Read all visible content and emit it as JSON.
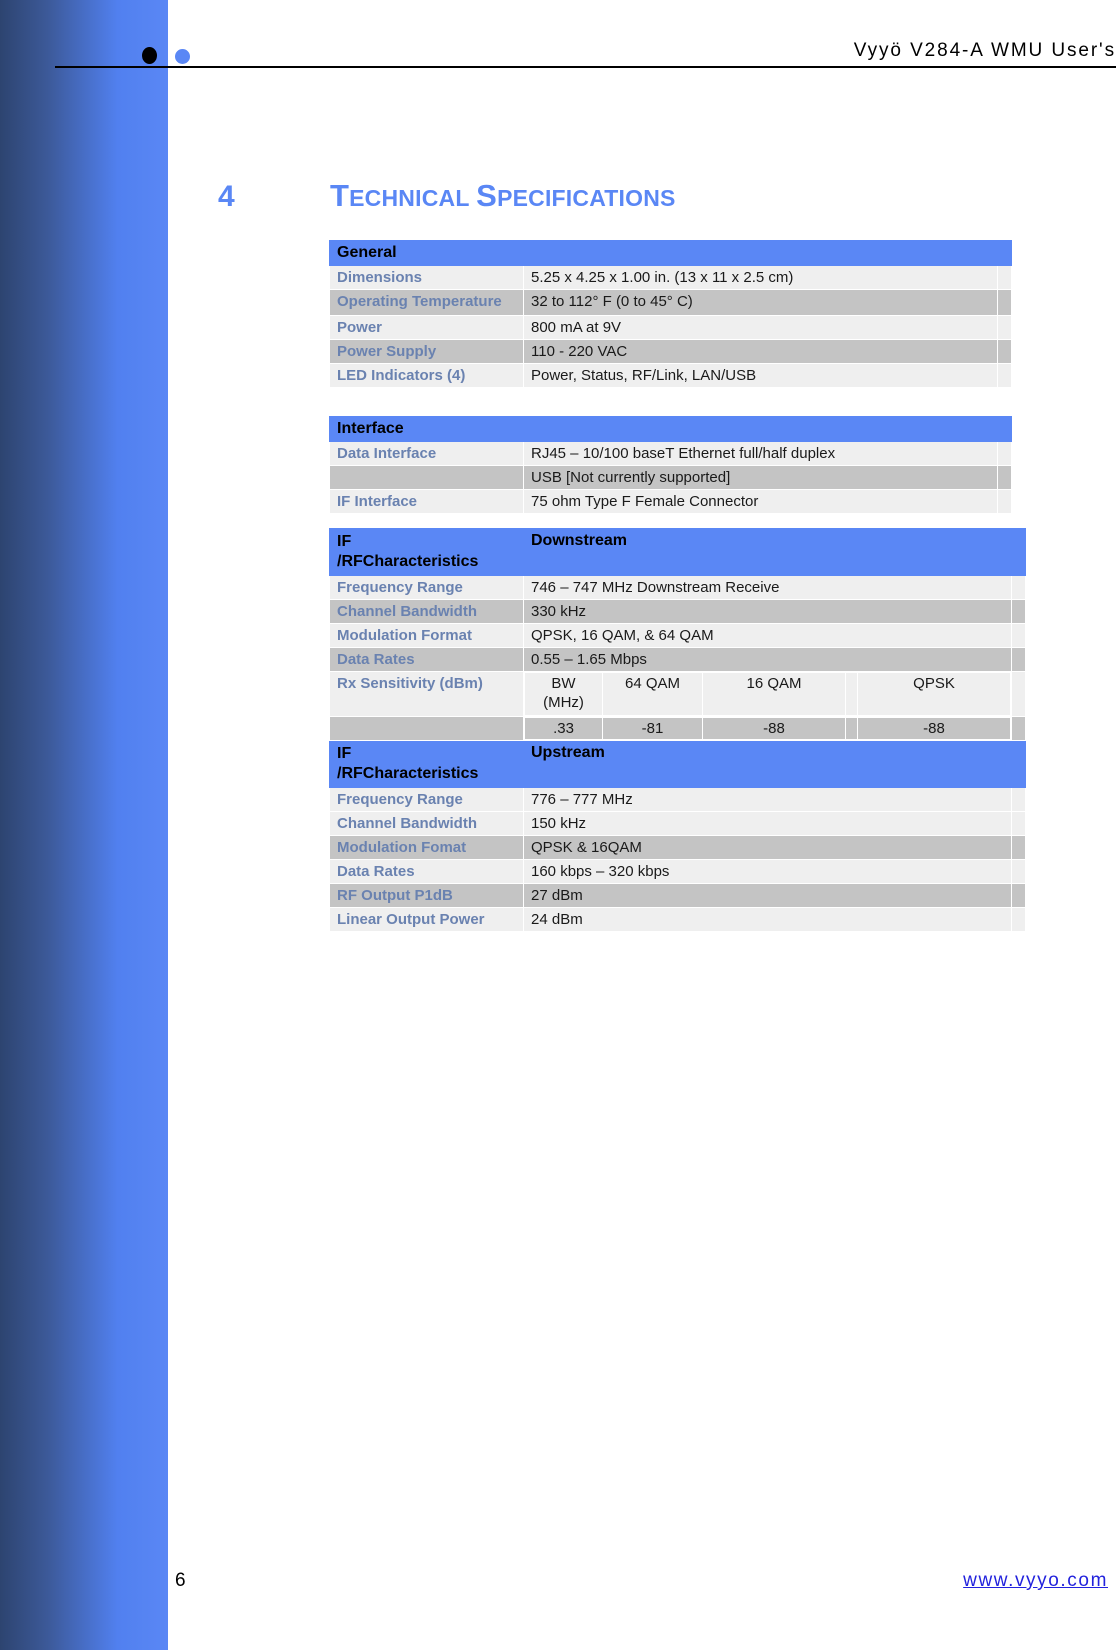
{
  "header": {
    "title": "Vyyö V284-A WMU User's",
    "logo_black_dot": "black-circle",
    "logo_blue_dot": "blue-circle"
  },
  "heading": {
    "number": "4",
    "title_parts": [
      {
        "cap": "T",
        "rest": "ECHNICAL"
      },
      {
        "cap": "S",
        "rest": "PECIFICATIONS"
      }
    ],
    "title_plain": "TECHNICAL SPECIFICATIONS",
    "color": "#5a87f5"
  },
  "tables": {
    "general": {
      "header": "General",
      "header_value": "",
      "rows": [
        {
          "label": "Dimensions",
          "value": "5.25 x 4.25 x 1.00 in. (13 x 11 x 2.5 cm)"
        },
        {
          "label": "Operating Temperature",
          "value": "32 to 112° F  (0 to 45° C)"
        },
        {
          "label": "Power",
          "value": "800 mA at 9V"
        },
        {
          "label": "Power Supply",
          "value": "110 - 220 VAC"
        },
        {
          "label": "LED Indicators (4)",
          "value": "Power, Status, RF/Link, LAN/USB"
        }
      ]
    },
    "interface": {
      "header": "Interface",
      "header_value": "",
      "rows": [
        {
          "label": "Data Interface",
          "value": "RJ45 – 10/100 baseT Ethernet full/half duplex"
        },
        {
          "label": "",
          "value": "USB [Not currently supported]"
        },
        {
          "label": "IF Interface",
          "value": "75 ohm Type F Female Connector"
        }
      ]
    },
    "downstream": {
      "header_label": "IF /RFCharacteristics",
      "header_label_line1": "IF",
      "header_label_line2": "/RFCharacteristics",
      "header_value": "Downstream",
      "rows": [
        {
          "label": "Frequency Range",
          "value": "746 – 747 MHz Downstream Receive"
        },
        {
          "label": "Channel Bandwidth",
          "value": "330 kHz"
        },
        {
          "label": "Modulation Format",
          "value": "QPSK, 16 QAM, & 64 QAM"
        },
        {
          "label": "Data Rates",
          "value": "0.55 – 1.65 Mbps"
        }
      ],
      "rx_sensitivity": {
        "label": "Rx Sensitivity (dBm)",
        "columns": [
          "BW (MHz)",
          "64 QAM",
          "16 QAM",
          "QPSK"
        ],
        "col_bw_line1": "BW",
        "col_bw_line2": "(MHz)",
        "values": [
          ".33",
          "-81",
          "-88",
          "-88"
        ]
      }
    },
    "upstream": {
      "header_label_line1": "IF",
      "header_label_line2": "/RFCharacteristics",
      "header_value": "Upstream",
      "rows": [
        {
          "label": "Frequency Range",
          "value": "776 – 777 MHz"
        },
        {
          "label": "Channel Bandwidth",
          "value": "150 kHz"
        },
        {
          "label": "Modulation Fomat",
          "value": "QPSK & 16QAM"
        },
        {
          "label": "Data Rates",
          "value": "160 kbps – 320 kbps"
        },
        {
          "label": "RF Output P1dB",
          "value": "27 dBm"
        },
        {
          "label": "Linear Output Power",
          "value": "24 dBm"
        }
      ]
    }
  },
  "footer": {
    "page_number": "6",
    "website": "www.vyyo.com"
  },
  "colors": {
    "accent_blue": "#5a87f5",
    "label_blue": "#6a82b0",
    "row_light": "#efefef",
    "row_dark": "#c4c4c4",
    "link_blue": "#2222dd"
  }
}
